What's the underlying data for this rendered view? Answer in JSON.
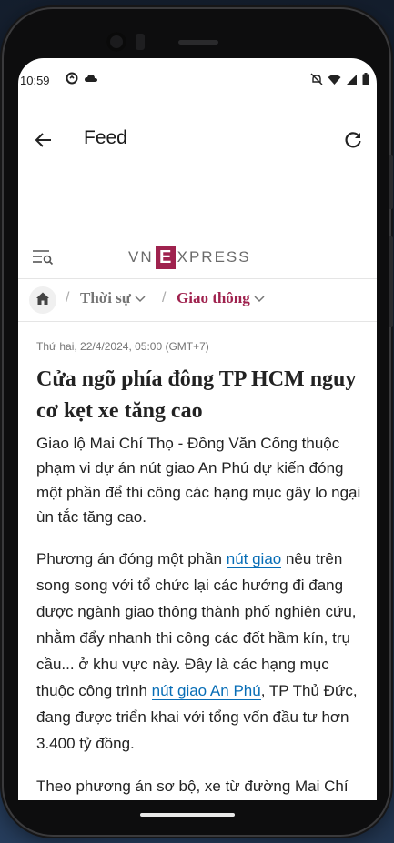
{
  "status": {
    "time": "10:59"
  },
  "appbar": {
    "title": "Feed"
  },
  "site": {
    "logo_left": "VN",
    "logo_box": "E",
    "logo_right": "XPRESS"
  },
  "breadcrumb": {
    "items": [
      "Thời sự",
      "Giao thông"
    ],
    "separator": "/"
  },
  "article": {
    "date": "Thứ hai, 22/4/2024, 05:00 (GMT+7)",
    "title": "Cửa ngõ phía đông TP HCM nguy cơ kẹt xe tăng cao",
    "lead": "Giao lộ Mai Chí Thọ - Đồng Văn Cống thuộc phạm vi dự án nút giao An Phú dự kiến đóng một phần để thi công các hạng mục gây lo ngại ùn tắc tăng cao.",
    "p1_a": "Phương án đóng một phần ",
    "p1_link1": "nút giao",
    "p1_b": " nêu trên song song với tổ chức lại các hướng đi đang được ngành giao thông thành phố nghiên cứu, nhằm đẩy nhanh thi công các đốt hầm kín, trụ cầu... ở khu vực này. Đây là các hạng mục thuộc công trình ",
    "p1_link2": "nút giao An Phú",
    "p1_c": ", TP Thủ Đức, đang được triển khai với tổng vốn đầu tư hơn 3.400 tỷ đồng.",
    "p2": "Theo phương án sơ bộ, xe từ đường Mai Chí"
  },
  "colors": {
    "brand": "#9f224e",
    "link": "#076db6"
  }
}
